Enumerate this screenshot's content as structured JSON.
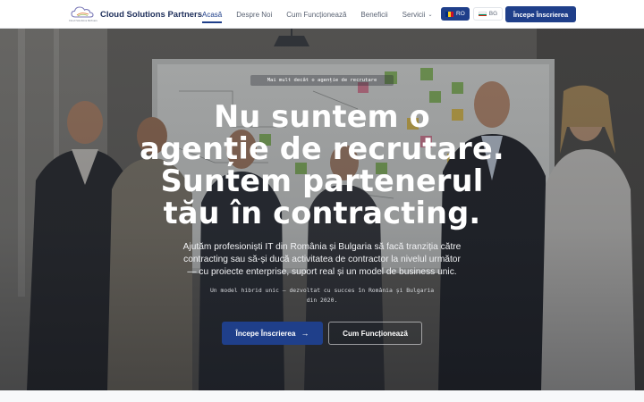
{
  "brand": {
    "name": "Cloud Solutions Partners",
    "logo_caption": "Cloud Solutions Partners",
    "logo_icon": "cloud-icon"
  },
  "nav": {
    "links": [
      {
        "label": "Acasă",
        "active": true
      },
      {
        "label": "Despre Noi",
        "active": false
      },
      {
        "label": "Cum Funcționează",
        "active": false
      },
      {
        "label": "Beneficii",
        "active": false
      },
      {
        "label": "Servicii",
        "active": false,
        "has_dropdown": true
      }
    ],
    "languages": [
      {
        "code": "RO",
        "selected": true,
        "flag_icon": "romania-flag-icon"
      },
      {
        "code": "BG",
        "selected": false,
        "flag_icon": "bulgaria-flag-icon"
      }
    ],
    "cta_label": "Începe Înscrierea"
  },
  "hero": {
    "eyebrow": "Mai mult decât o agenție de recrutare",
    "headline_lines": [
      "Nu suntem o",
      "agenție de recrutare.",
      "Suntem partenerul",
      "tău în contracting."
    ],
    "subtext_lines": [
      "Ajutăm profesioniști IT din România și Bulgaria să facă tranziția către",
      "contracting sau să-și ducă activitatea de contractor la nivelul următor",
      "— cu proiecte enterprise, suport real și un model de business unic."
    ],
    "note_lines": [
      "Un model hibrid unic — dezvoltat cu succes în România și Bulgaria",
      "din 2020."
    ],
    "primary_button": "Începe Înscrierea",
    "primary_button_icon": "arrow-right-icon",
    "secondary_button": "Cum Funcționează"
  },
  "colors": {
    "brand_navy": "#1f3f8a",
    "brand_text": "#1d2e5a",
    "nav_text": "#5b6474",
    "hero_text": "#ffffff"
  }
}
